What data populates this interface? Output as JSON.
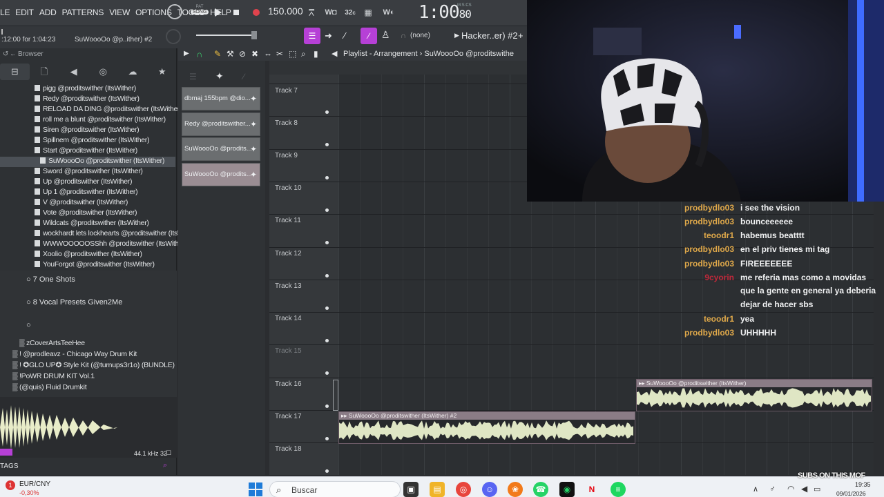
{
  "menus": [
    "LE",
    "EDIT",
    "ADD",
    "PATTERNS",
    "VIEW",
    "OPTIONS",
    "TOOLS",
    "HELP"
  ],
  "transport": {
    "mode_top": "PAT",
    "mode_bottom": "SONG",
    "tempo": "150.000",
    "time_main": "1:00",
    "time_sub": "80",
    "time_unit": "M:S:CS",
    "rec_label": "32"
  },
  "hint": ":12:00 for 1:04:23",
  "project_hint": "SuWoooOo @p..ither) #2",
  "snap": "(none)",
  "pattern": "Hacker..er) #2",
  "browser": {
    "title": "Browser",
    "files": [
      "pigg @proditswither (ItsWither)",
      "Redy @proditswither (ItsWither)",
      "RELOAD DA DING @proditswither (ItsWither)",
      "roll me a blunt @proditswither (ItsWither)",
      "Siren @proditswither (ItsWither)",
      "Spillnem @proditswither (ItsWither)",
      "Start @proditswither (ItsWither)",
      "SuWoooOo @proditswither (ItsWither)",
      "Sword @proditswither (ItsWither)",
      "Up @proditswither (ItsWither)",
      "Up 1 @proditswither (ItsWither)",
      "V @proditswither (ItsWither)",
      "Vote @proditswither (ItsWither)",
      "Wildcats @proditswither (ItsWither)",
      "wockhardt lets lockhearts @proditswither (ItsWither)",
      "WWWOOOOOSShh @proditswither (ItsWither)",
      "Xoolio @proditswither (ItsWither)",
      "YouForgot @proditswither (ItsWither)"
    ],
    "selected_index": 7,
    "folders": [
      "7 One Shots",
      "8 Vocal Presets Given2Me"
    ],
    "packs": [
      "zCoverArtsTeeHee",
      "! @prodleavz - Chicago Way Drum Kit",
      "! ✪GLO UP✪ Style Kit (@turnups3r1o) (BUNDLE)",
      "!PoWR DRUM KIT Vol.1",
      "(@quis) Fluid Drumkit"
    ],
    "sample_rate": "44.1 kHz 32",
    "tags": "TAGS"
  },
  "channels": [
    {
      "label": "dbmaj 155bpm @dio...",
      "style": "gray"
    },
    {
      "label": "Redy @proditswither...",
      "style": "gray"
    },
    {
      "label": "SuWoooOo @prodits...",
      "style": "gray"
    },
    {
      "label": "SuWoooOo @prodits...",
      "style": "pink"
    }
  ],
  "playlist": {
    "title": "Playlist - Arrangement › SuWoooOo @proditswithe",
    "tracks": [
      "Track 7",
      "Track 8",
      "Track 9",
      "Track 10",
      "Track 11",
      "Track 12",
      "Track 13",
      "Track 14",
      "Track 15",
      "Track 16",
      "Track 17",
      "Track 18"
    ],
    "clips": [
      {
        "track": "Track 16",
        "label": "SuWoooOo @proditswither (ItsWither)"
      },
      {
        "track": "Track 17",
        "label": "SuWoooOo @proditswither (ItsWither) #2"
      }
    ]
  },
  "chat": [
    {
      "user": "prodbydlo03",
      "color": "#e0a94a",
      "msg": "i see the vision"
    },
    {
      "user": "prodbydlo03",
      "color": "#e0a94a",
      "msg": "bounceeeeee"
    },
    {
      "user": "teoodr1",
      "color": "#e0a94a",
      "msg": "habemus beatttt"
    },
    {
      "user": "prodbydlo03",
      "color": "#e0a94a",
      "msg": "en el priv tienes mi tag"
    },
    {
      "user": "prodbydlo03",
      "color": "#e0a94a",
      "msg": "FIREEEEEEE"
    },
    {
      "user": "9cyorin",
      "color": "#c0283a",
      "msg": "me referia mas como a movidas"
    },
    {
      "user": "",
      "color": "#e0a94a",
      "msg": "que la gente en general ya deberia"
    },
    {
      "user": "",
      "color": "#e0a94a",
      "msg": "dejar de hacer sbs"
    },
    {
      "user": "teoodr1",
      "color": "#e0a94a",
      "msg": "yea"
    },
    {
      "user": "prodbydlo03",
      "color": "#e0a94a",
      "msg": "UHHHHH"
    }
  ],
  "taskbar": {
    "ticker_name": "EUR/CNY",
    "ticker_value": "-0,30%",
    "search_placeholder": "Buscar",
    "time": "19:35",
    "date": "09/01/2026",
    "watermark": "SUBS ON THIS MOF"
  }
}
